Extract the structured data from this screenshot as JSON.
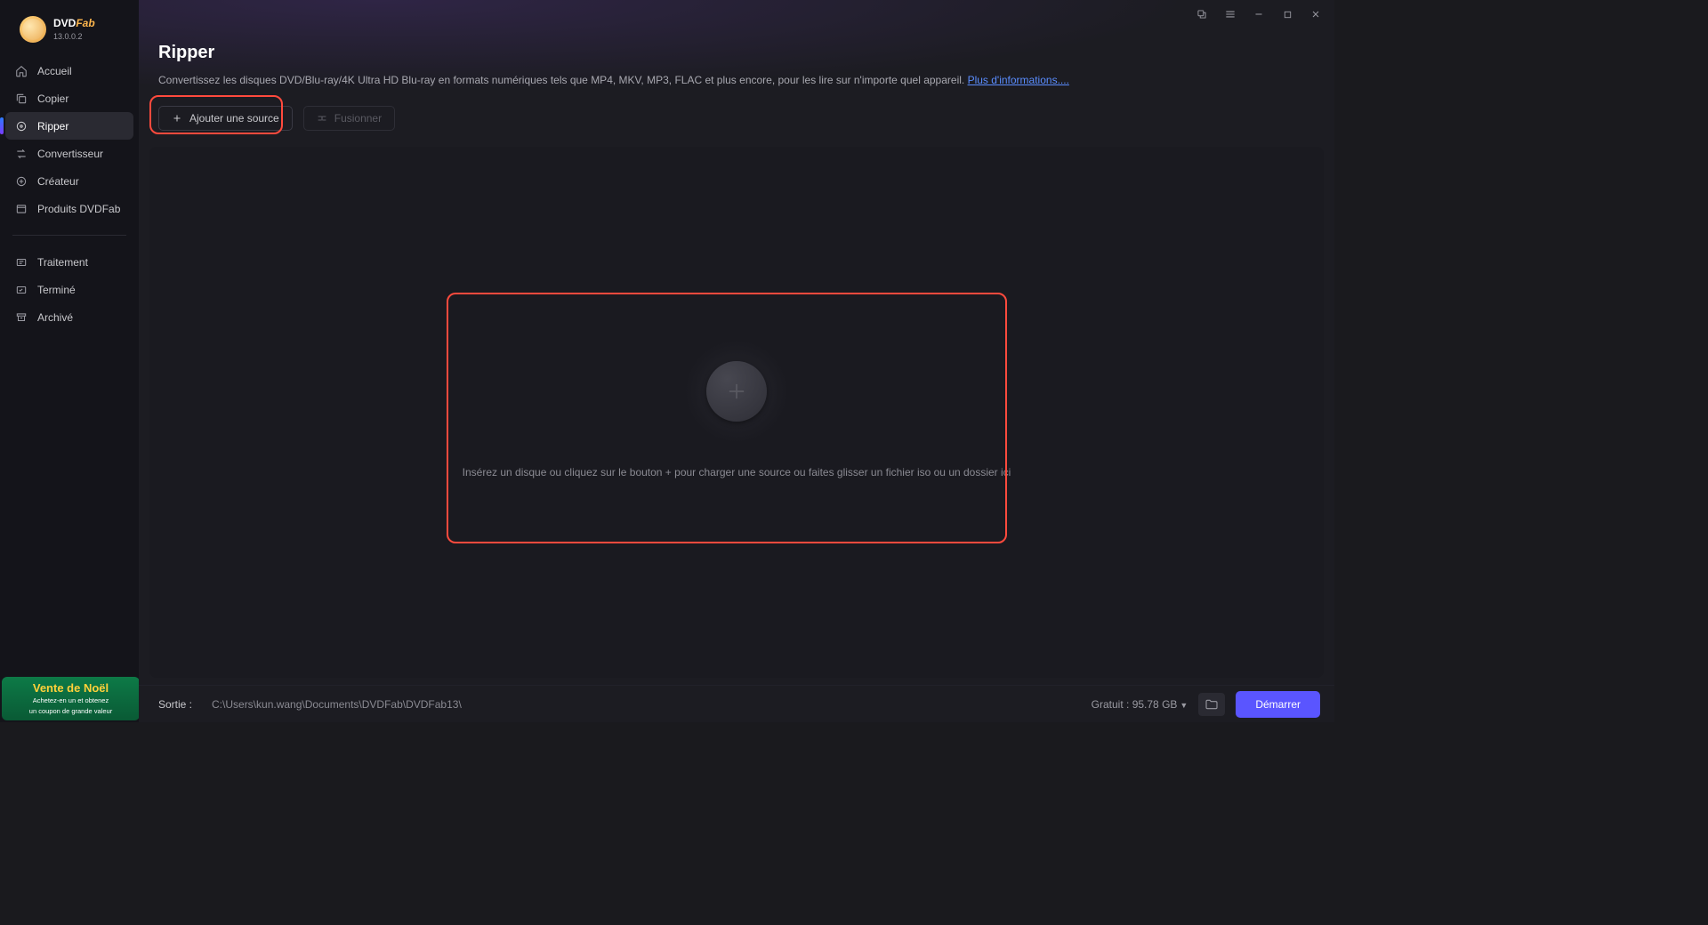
{
  "app": {
    "name_part1": "DVD",
    "name_part2": "Fab",
    "version": "13.0.0.2"
  },
  "sidebar": {
    "items": [
      {
        "label": "Accueil"
      },
      {
        "label": "Copier"
      },
      {
        "label": "Ripper"
      },
      {
        "label": "Convertisseur"
      },
      {
        "label": "Créateur"
      },
      {
        "label": "Produits DVDFab"
      }
    ],
    "items2": [
      {
        "label": "Traitement"
      },
      {
        "label": "Terminé"
      },
      {
        "label": "Archivé"
      }
    ]
  },
  "promo": {
    "title": "Vente de Noël",
    "line1": "Achetez-en un et obtenez",
    "line2": "un coupon de grande valeur"
  },
  "header": {
    "title": "Ripper",
    "desc": "Convertissez les disques DVD/Blu-ray/4K Ultra HD Blu-ray en formats numériques tels que MP4, MKV, MP3, FLAC et plus encore, pour les lire sur n'importe quel appareil. ",
    "more_link": "Plus d'informations...."
  },
  "toolbar": {
    "add_source": "Ajouter une source",
    "merge": "Fusionner"
  },
  "dropzone": {
    "text": "Insérez un disque ou cliquez sur le bouton +  pour charger une source ou faites glisser un fichier iso ou un dossier ici"
  },
  "footer": {
    "output_label": "Sortie :",
    "output_path": "C:\\Users\\kun.wang\\Documents\\DVDFab\\DVDFab13\\",
    "free_label": "Gratuit :",
    "free_value": "95.78 GB",
    "start": "Démarrer"
  }
}
